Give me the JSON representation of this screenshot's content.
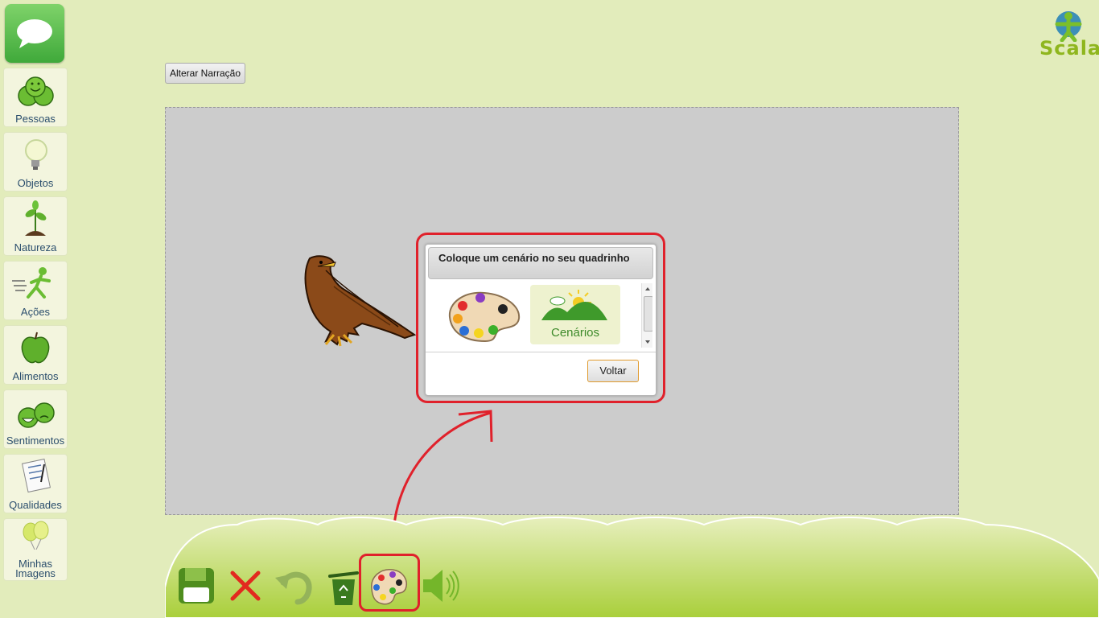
{
  "sidebar": {
    "categories": [
      {
        "label": "Pessoas",
        "icon": "people-icon"
      },
      {
        "label": "Objetos",
        "icon": "lightbulb-icon"
      },
      {
        "label": "Natureza",
        "icon": "plant-icon"
      },
      {
        "label": "Ações",
        "icon": "running-person-icon"
      },
      {
        "label": "Alimentos",
        "icon": "apple-icon"
      },
      {
        "label": "Sentimentos",
        "icon": "emotions-icon"
      },
      {
        "label": "Qualidades",
        "icon": "checklist-icon"
      },
      {
        "label": "Minhas Imagens",
        "icon": "balloons-icon"
      }
    ]
  },
  "logo": {
    "text": "Scala"
  },
  "narration_button": {
    "label": "Alterar Narração"
  },
  "dialog": {
    "title": "Coloque um cenário no seu quadrinho",
    "options": [
      {
        "icon": "paint-palette-icon"
      },
      {
        "label": "Cenários",
        "icon": "landscape-icon"
      }
    ],
    "back_button": "Voltar"
  },
  "toolbar": {
    "tools": [
      "save-icon",
      "close-icon",
      "undo-icon",
      "trash-icon",
      "paint-palette-icon",
      "speaker-icon"
    ]
  },
  "colors": {
    "background": "#e2ecbb",
    "canvas": "#cccccc",
    "highlight": "#e0212b",
    "brand_green": "#8fb61e"
  }
}
